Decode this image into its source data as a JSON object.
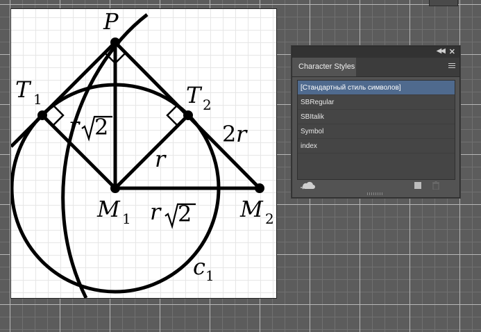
{
  "figure": {
    "labels": {
      "P": "P",
      "T": "T",
      "T1_sub": "1",
      "T2_sub": "2",
      "r": "r",
      "two": "2",
      "two_r_num": "2",
      "M": "M",
      "M1_sub": "1",
      "M2_sub": "2",
      "c": "c",
      "c1_sub": "1"
    }
  },
  "panel": {
    "title_tab": "Character Styles",
    "styles": [
      "[Стандартный стиль символов]",
      "SBRegular",
      "SBItalik",
      "Symbol",
      "index"
    ],
    "selected_index": 0,
    "accent_color": "#4f6a8e"
  }
}
